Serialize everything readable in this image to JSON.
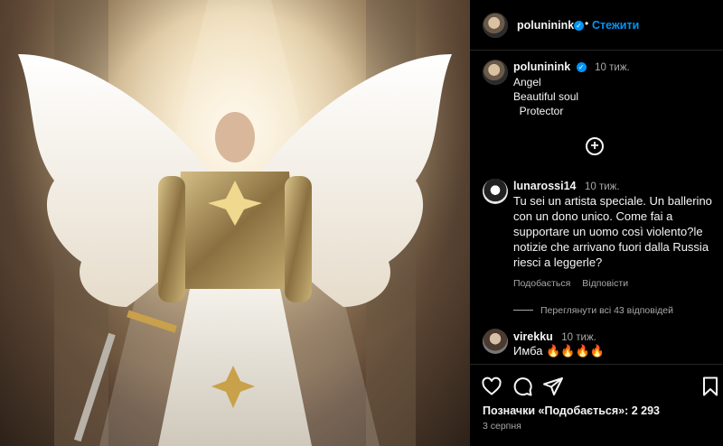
{
  "post": {
    "author": "poluninink",
    "follow_label": "Стежити",
    "dot": "•",
    "caption_time": "10 тиж.",
    "caption_text": "Angel\nBeautiful soul\n  Protector",
    "likes_text": "Позначки «Подобається»: 2 293",
    "date": "3 серпня"
  },
  "comments": [
    {
      "user": "lunarossi14",
      "time": "10 тиж.",
      "text": "Tu sei un artista speciale. Un ballerino con un dono unico. Come fai a supportare un uomo così violento?le notizie che arrivano fuori dalla Russia riesci a leggerle?",
      "like_label": "Подобається",
      "reply_label": "Відповісти",
      "view_replies": "Переглянути всі 43 відповідей"
    },
    {
      "user": "virekku",
      "time": "10 тиж.",
      "text": "Имба 🔥🔥🔥🔥"
    }
  ],
  "icons": {
    "verified": "verified-badge-icon",
    "more": "plus-circle-icon",
    "like": "heart-icon",
    "comment": "comment-icon",
    "share": "share-icon",
    "save": "bookmark-icon"
  },
  "colors": {
    "accent": "#0095f6",
    "background": "#000000",
    "muted": "#a8a8a8"
  }
}
